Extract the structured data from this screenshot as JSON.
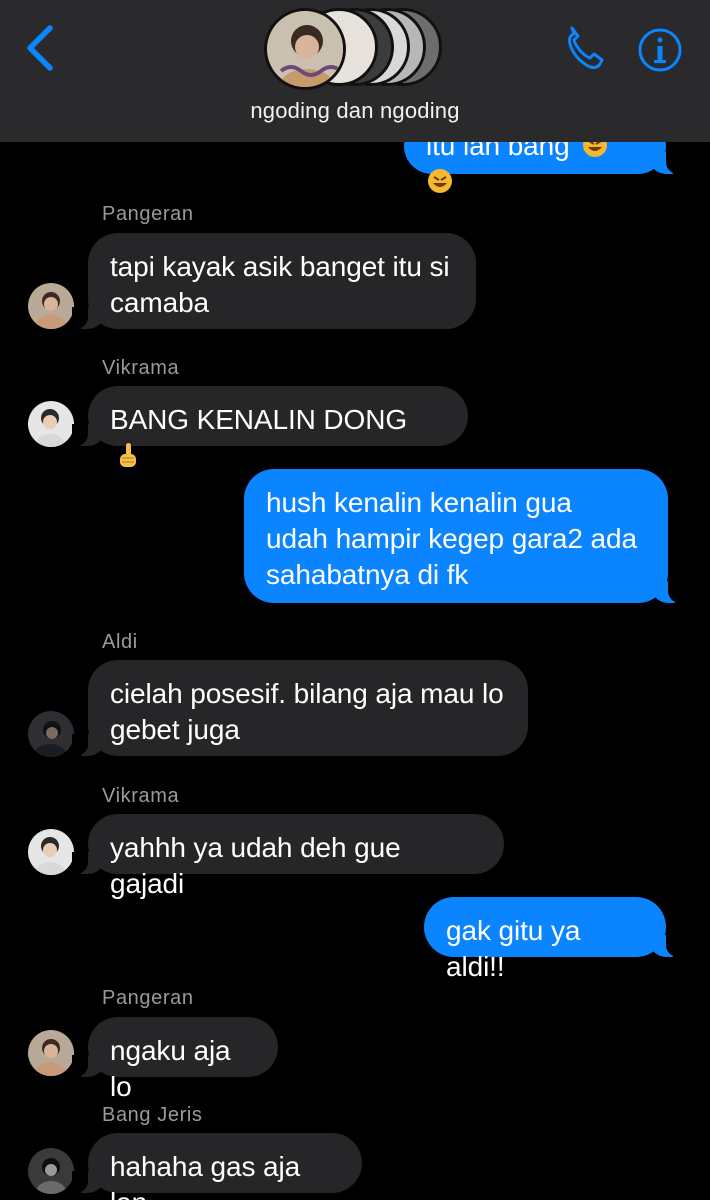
{
  "header": {
    "group_name": "ngoding dan ngoding",
    "icons": [
      "chevron-left-icon",
      "phone-icon",
      "info-icon"
    ],
    "accent": "#0a84ff",
    "background": "#2a2a2c"
  },
  "messages": [
    {
      "direction": "out",
      "text": "itu lan bang",
      "emoji": [
        "rofl-emoji",
        "rofl-emoji"
      ]
    },
    {
      "direction": "in",
      "sender": "Pangeran",
      "text": "tapi kayak asik banget itu si\ncamaba"
    },
    {
      "direction": "in",
      "sender": "Vikrama",
      "text": "BANG KENALIN DONG",
      "emoji": [
        "pointing-up-emoji"
      ]
    },
    {
      "direction": "out",
      "text": "hush kenalin kenalin gua\nudah hampir kegep gara2 ada\nsahabatnya di fk"
    },
    {
      "direction": "in",
      "sender": "Aldi",
      "text": "cielah posesif. bilang aja mau lo\ngebet juga"
    },
    {
      "direction": "in",
      "sender": "Vikrama",
      "text": "yahhh ya udah deh gue gajadi"
    },
    {
      "direction": "out",
      "text": "gak gitu ya aldi!!"
    },
    {
      "direction": "in",
      "sender": "Pangeran",
      "text": "ngaku aja lo"
    },
    {
      "direction": "in",
      "sender": "Bang Jeris",
      "text": "hahaha gas aja lan"
    }
  ],
  "colors": {
    "incoming_bubble": "#262628",
    "outgoing_bubble": "#0a84ff",
    "sender_name": "#9a9a9e",
    "background": "#000000"
  }
}
